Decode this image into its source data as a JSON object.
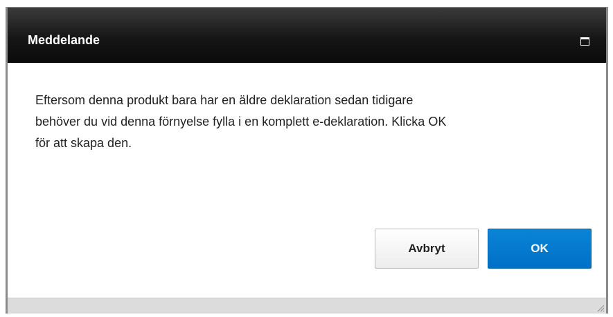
{
  "dialog": {
    "title": "Meddelande",
    "maximize_icon": "maximize-icon",
    "message_lines": [
      "Eftersom denna produkt bara har en äldre deklaration sedan tidigare",
      "behöver du vid denna förnyelse fylla i en komplett e-deklaration. Klicka OK",
      "för att skapa den."
    ],
    "buttons": {
      "cancel_label": "Avbryt",
      "ok_label": "OK"
    },
    "resize_icon": "resize-grip-icon"
  },
  "colors": {
    "titlebar": "#161616",
    "ok_button": "#0077cc",
    "statusbar": "#dcdcdc"
  }
}
